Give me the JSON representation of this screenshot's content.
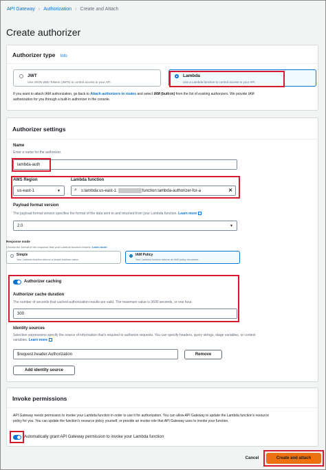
{
  "breadcrumb": {
    "items": [
      "API Gateway",
      "Authorization"
    ],
    "current": "Create and Attach"
  },
  "page": {
    "title": "Create authorizer"
  },
  "authorizer_type": {
    "title": "Authorizer type",
    "info": "Info",
    "jwt": {
      "title": "JWT",
      "desc": "Use JSON Web Tokens (JWTs) to control access to your API."
    },
    "lambda": {
      "title": "Lambda",
      "desc": "Use a Lambda function to control access to your API."
    },
    "selected": "Lambda",
    "note_pre": "If you want to attach IAM authorization, go back to ",
    "note_link": "Attach authorizers to routes",
    "note_mid": " and select ",
    "note_bold": "IAM (built-in)",
    "note_post": " from the list of existing authorizers. We provide IAM",
    "note_line2": "authorization for you through a built-in authorizer in the console."
  },
  "authorizer_settings": {
    "title": "Authorizer settings",
    "name_label": "Name",
    "name_hint": "Enter a name for the authorizer.",
    "name_value": "lambda-auth",
    "region_label": "AWS Region",
    "region_value": "us-east-1",
    "lambda_label": "Lambda function",
    "lambda_value_a": "s:lambda:us-east-1:",
    "lambda_value_b": "function:lambda-authorizer-for-a",
    "payload_label": "Payload format version",
    "payload_hint": "The payload format version specifies the format of the data sent to and returned from your Lambda function.",
    "payload_learn": "Learn more",
    "payload_value": "2.0",
    "response_label": "Response mode",
    "response_hint": "Choose the format of the response that your Lambda function returns.",
    "response_learn": "Learn more",
    "simple": {
      "title": "Simple",
      "desc": "Your Lambda function returns a simple boolean value."
    },
    "iam_policy": {
      "title": "IAM Policy",
      "desc": "Your Lambda function returns an IAM policy document."
    },
    "response_selected": "IAM Policy",
    "caching_label": "Authorizer caching",
    "caching_enabled": true,
    "cache_duration_label": "Authorizer cache duration",
    "cache_duration_hint": "The number of seconds that cached authorization results are valid. The maximum value is 3600 seconds, or one hour.",
    "cache_duration_value": "300",
    "identity_label": "Identity sources",
    "identity_hint_1": "Selection expressions specify the source of information that's required to authorize requests. You can specify headers, query strings, stage variables, or context",
    "identity_hint_2": "variables.",
    "identity_learn": "Learn more",
    "identity_value": "$request.header.Authorization",
    "remove_label": "Remove",
    "add_identity_label": "Add identity source"
  },
  "invoke_permissions": {
    "title": "Invoke permissions",
    "desc_1": "API Gateway needs permission to invoke your Lambda function in order to use it for authorization. You can allow API Gateway to update the Lambda function's resource",
    "desc_2": "policy for you. You can update the function's resource policy yourself, or provide an invoke role that API Gateway uses to invoke your function.",
    "toggle_label": "Automatically grant API Gateway permission to invoke your Lambda function",
    "toggle_enabled": true
  },
  "footer": {
    "cancel_label": "Cancel",
    "submit_label": "Create and attach"
  },
  "colors": {
    "accent": "#0972d3",
    "highlight": "#d7192f",
    "primary_button": "#ec7211"
  },
  "icons": [
    "chevron-right-icon",
    "search-icon",
    "clear-icon",
    "external-link-icon",
    "caret-down-icon"
  ]
}
